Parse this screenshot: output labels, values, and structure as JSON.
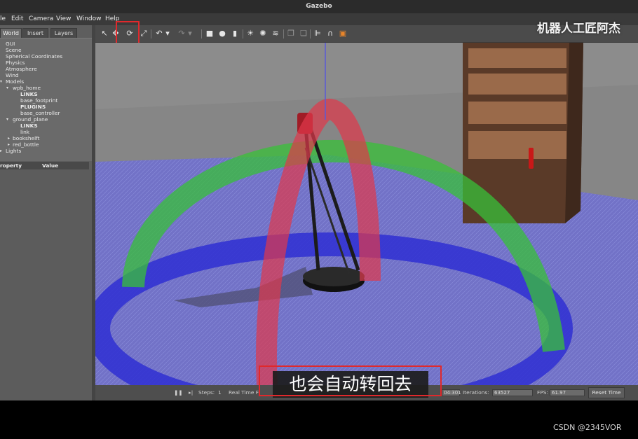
{
  "window": {
    "title": "Gazebo"
  },
  "menu": [
    "le",
    "Edit",
    "Camera",
    "View",
    "Window",
    "Help"
  ],
  "tabs": [
    "World",
    "Insert",
    "Layers"
  ],
  "tree": {
    "gui": "GUI",
    "scene": "Scene",
    "spherical": "Spherical Coordinates",
    "physics": "Physics",
    "atmosphere": "Atmosphere",
    "wind": "Wind",
    "models": "Models",
    "wpb_home": "wpb_home",
    "links1": "LINKS",
    "base_footprint": "base_footprint",
    "plugins": "PLUGINS",
    "base_controller": "base_controller",
    "ground_plane": "ground_plane",
    "links2": "LINKS",
    "link": "link",
    "bookshelf": "bookshelft",
    "red_bottle": "red_bottle",
    "lights": "Lights"
  },
  "properties": {
    "col1": "roperty",
    "col2": "Value"
  },
  "toolbar": {
    "select": "↖",
    "translate": "✥",
    "rotate": "⟳",
    "scale": "⤢",
    "undo": "↶",
    "undo_menu": "▾",
    "redo": "↷",
    "redo_menu": "▾",
    "box": "■",
    "sphere": "●",
    "cylinder": "▮",
    "point_light": "☀",
    "spot_light": "✺",
    "dir_light": "≋",
    "copy": "❐",
    "paste": "❏",
    "align": "⊫",
    "snap": "∩",
    "screenshot": "▣"
  },
  "status": {
    "pause": "❚❚",
    "step": "▸|",
    "steps_label": "Steps:",
    "steps_value": "1",
    "realtime_label": "Real Time F",
    "sim_time": "04:301",
    "iterations_label": "Iterations:",
    "iterations_value": "63527",
    "fps_label": "FPS:",
    "fps_value": "61.97",
    "reset": "Reset Time"
  },
  "overlay": {
    "watermark": "机器人工匠阿杰",
    "subtitle": "也会自动转回去",
    "credit": "CSDN @2345VOR"
  },
  "colors": {
    "highlight": "#e0292c",
    "ring_blue": "#3a3ad8",
    "ring_green": "#39c039",
    "ring_red": "#e03a4a"
  }
}
